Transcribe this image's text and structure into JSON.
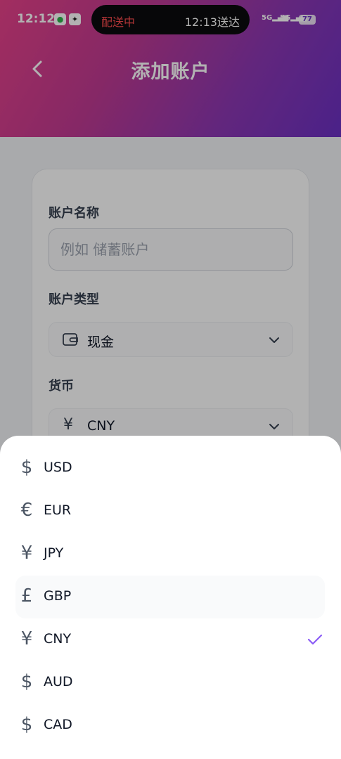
{
  "status_bar": {
    "time": "12:12",
    "delivery_status": "配送中",
    "delivery_eta": "12:13送达",
    "signal_1": "5G",
    "signal_2": "5G",
    "battery": "77"
  },
  "header": {
    "title": "添加账户",
    "back_icon": "chevron-left-icon",
    "gradient_colors": [
      "#e8428a",
      "#6b31c4"
    ]
  },
  "form": {
    "name_label": "账户名称",
    "name_placeholder": "例如 储蓄账户",
    "name_value": "",
    "type_label": "账户类型",
    "type_icon": "wallet-icon",
    "type_value": "现金",
    "currency_label": "货币",
    "currency_symbol": "¥",
    "currency_value": "CNY"
  },
  "currency_sheet": {
    "selected": "CNY",
    "accent_color": "#8b5cf6",
    "options": [
      {
        "symbol": "$",
        "code": "USD"
      },
      {
        "symbol": "€",
        "code": "EUR"
      },
      {
        "symbol": "¥",
        "code": "JPY"
      },
      {
        "symbol": "£",
        "code": "GBP"
      },
      {
        "symbol": "¥",
        "code": "CNY"
      },
      {
        "symbol": "$",
        "code": "AUD"
      },
      {
        "symbol": "$",
        "code": "CAD"
      }
    ]
  }
}
